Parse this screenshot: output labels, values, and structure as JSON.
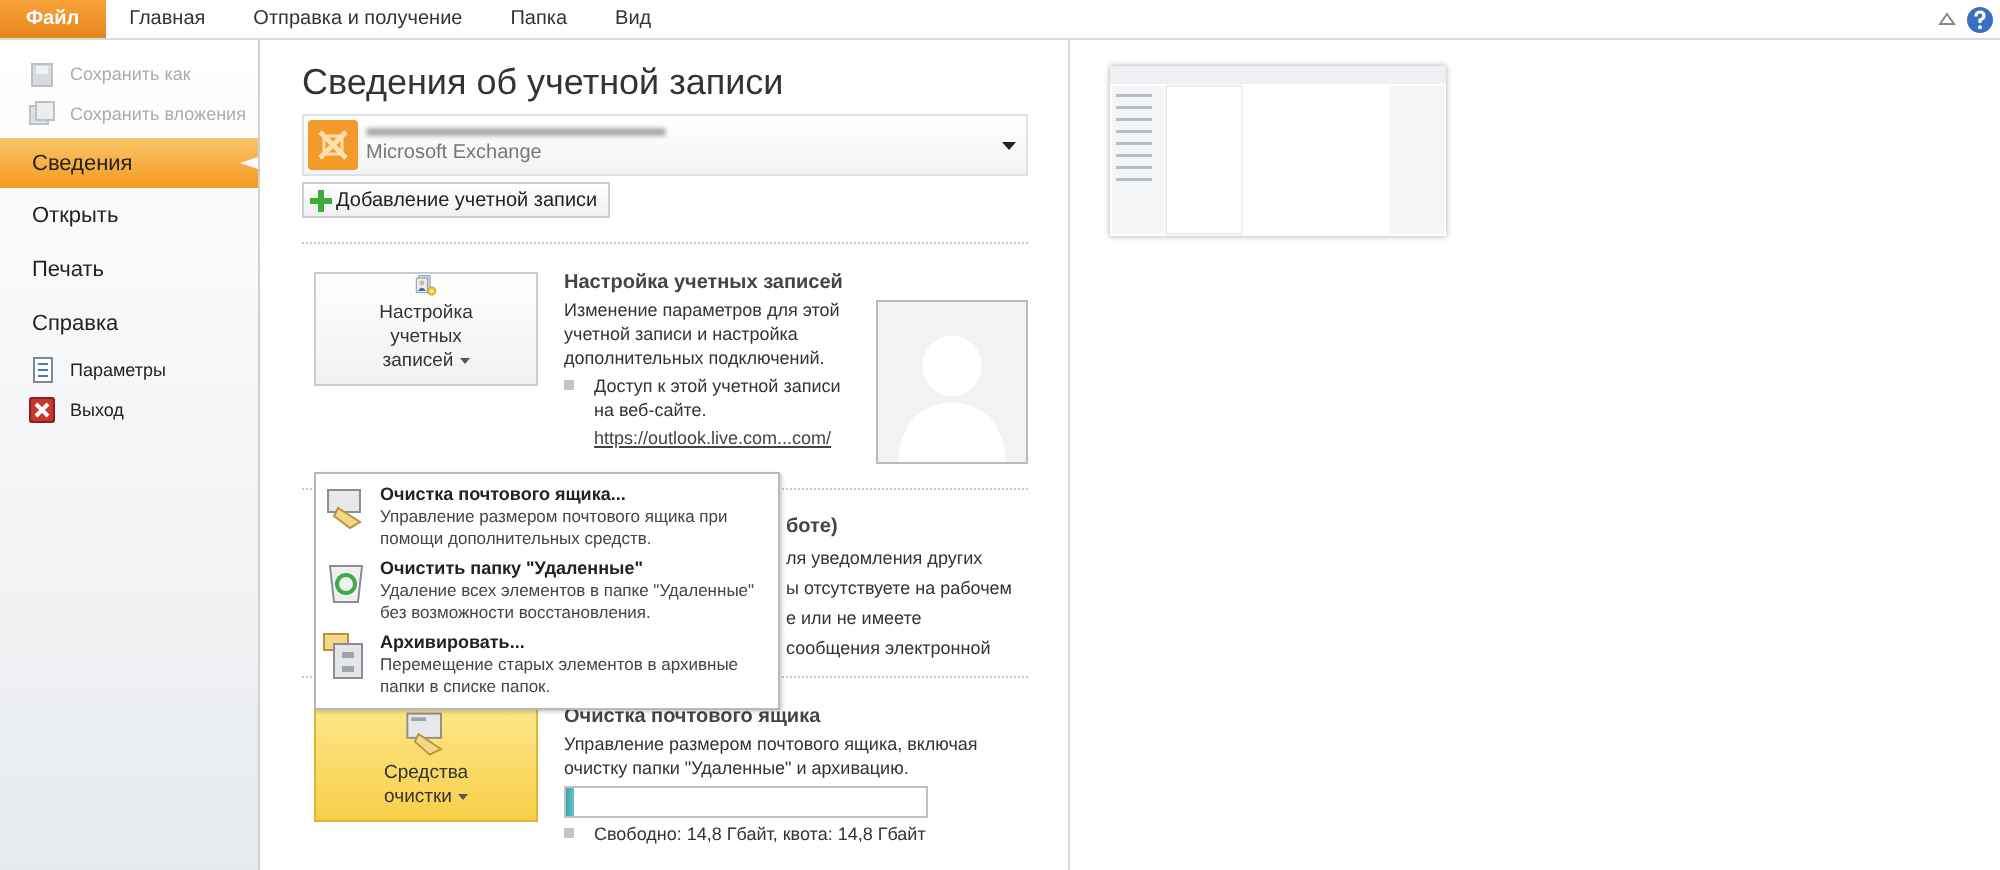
{
  "ribbon_tabs": [
    {
      "label": "Файл",
      "selected": true
    },
    {
      "label": "Главная",
      "selected": false
    },
    {
      "label": "Отправка и получение",
      "selected": false
    },
    {
      "label": "Папка",
      "selected": false
    },
    {
      "label": "Вид",
      "selected": false
    }
  ],
  "sidebar": {
    "items": [
      {
        "label": "Сохранить как",
        "kind": "command",
        "disabled": true,
        "selected": false
      },
      {
        "label": "Сохранить вложения",
        "kind": "command",
        "disabled": true,
        "selected": false
      },
      {
        "label": "Сведения",
        "kind": "page",
        "disabled": false,
        "selected": true
      },
      {
        "label": "Открыть",
        "kind": "page",
        "disabled": false,
        "selected": false
      },
      {
        "label": "Печать",
        "kind": "page",
        "disabled": false,
        "selected": false
      },
      {
        "label": "Справка",
        "kind": "page",
        "disabled": false,
        "selected": false
      },
      {
        "label": "Параметры",
        "kind": "command",
        "disabled": false,
        "selected": false
      },
      {
        "label": "Выход",
        "kind": "command",
        "disabled": false,
        "selected": false
      }
    ]
  },
  "page_title": "Сведения об учетной записи",
  "account": {
    "type": "Microsoft Exchange",
    "add_button": "Добавление учетной записи"
  },
  "sections": [
    {
      "kind": "settings",
      "button": "Настройка учетных записей",
      "highlighted": false,
      "heading": "Настройка учетных записей",
      "description": "Изменение параметров для этой учетной записи и настройка дополнительных подключений.",
      "bullet": "Доступ к этой учетной записи на веб-сайте.",
      "link": "https://outlook.live.com...com/"
    },
    {
      "kind": "covered",
      "lines": [
        "боте)",
        "ля уведомления других",
        "ы отсутствуете на рабочем",
        "е или не имеете",
        "сообщения электронной"
      ]
    },
    {
      "kind": "cleanup",
      "button": "Средства очистки",
      "highlighted": true,
      "heading": "Очистка почтового ящика",
      "description": "Управление размером почтового ящика, включая очистку папки \"Удаленные\" и архивацию.",
      "level": 0.02,
      "reading": "Свободно: 14,8 Гбайт, квота: 14,8 Гбайт"
    }
  ],
  "cleanup_menu": [
    {
      "title": "Очистка почтового ящика...",
      "description": "Управление размером почтового ящика при помощи дополнительных средств."
    },
    {
      "title": "Очистить папку \"Удаленные\"",
      "description": "Удаление всех элементов в папке \"Удаленные\" без возможности восстановления."
    },
    {
      "title": "Архивировать...",
      "description": "Перемещение старых элементов в архивные папки в списке папок."
    }
  ]
}
